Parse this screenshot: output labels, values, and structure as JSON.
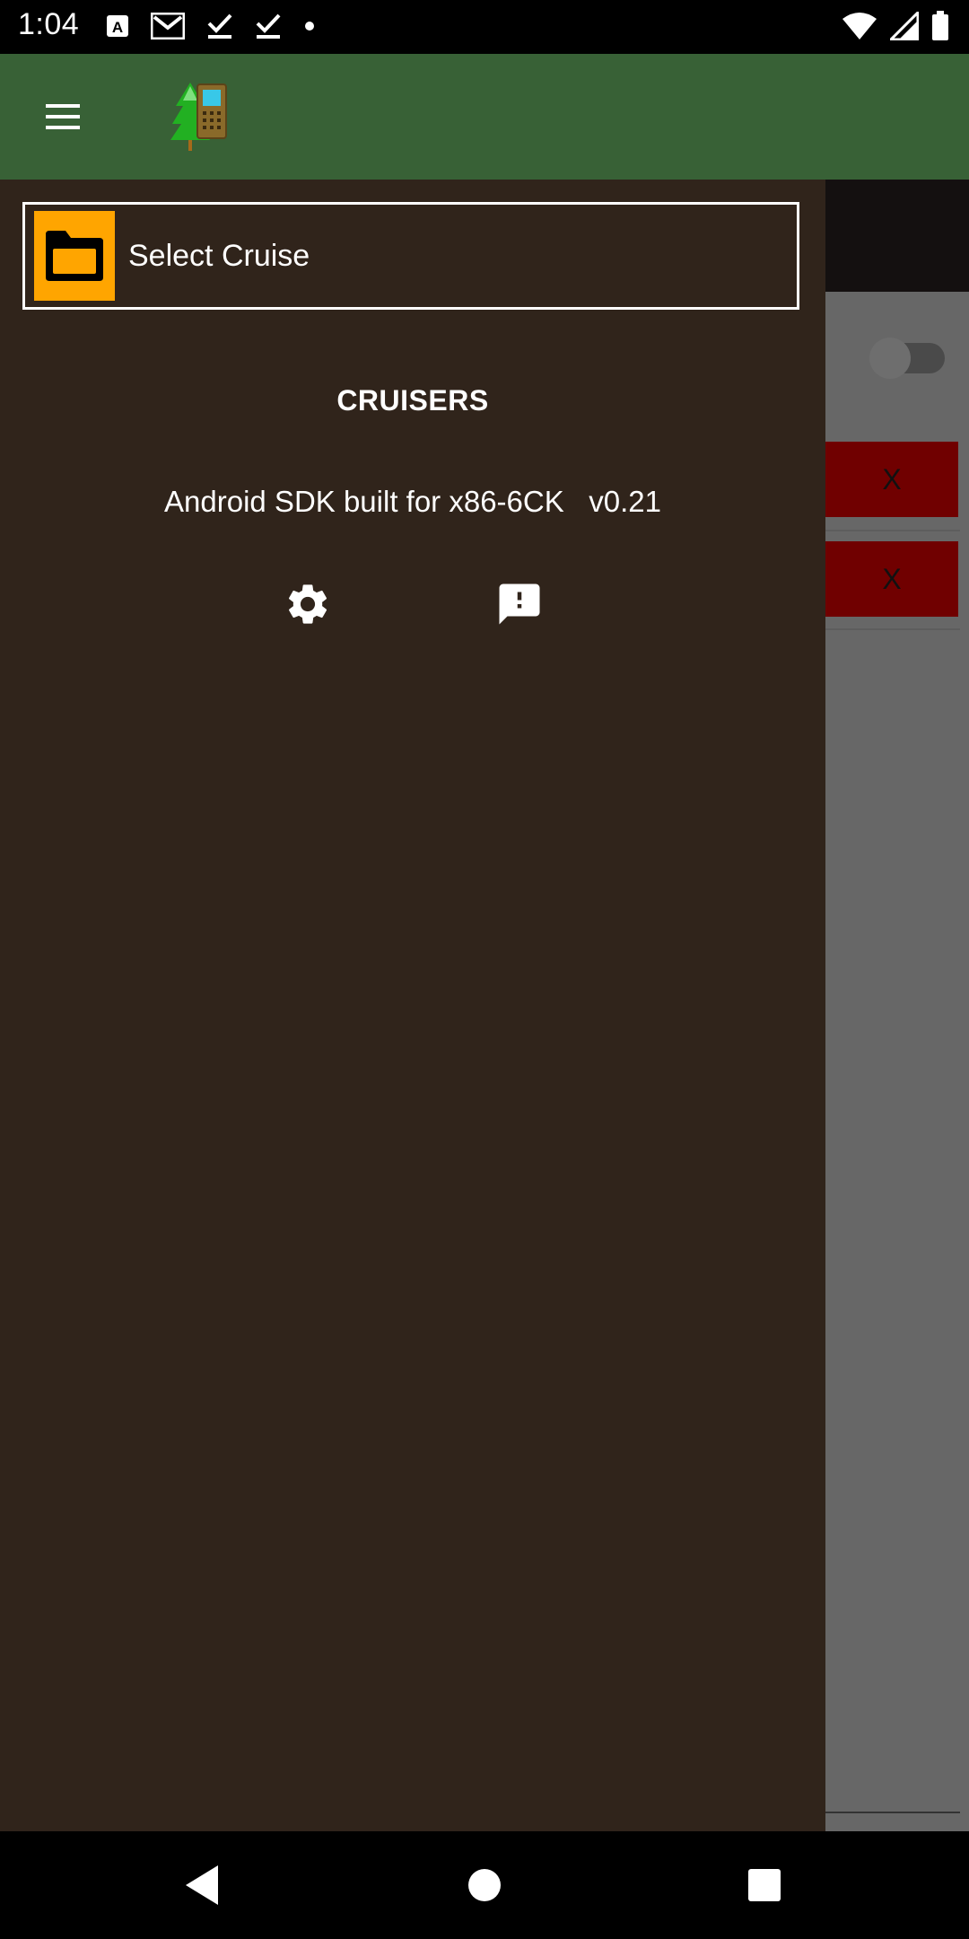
{
  "status_bar": {
    "time": "1:04",
    "left_icons": [
      "a-notification-icon",
      "gmail-icon",
      "download-done-icon",
      "download-done-icon",
      "dot-icon"
    ],
    "right_icons": [
      "wifi-icon",
      "signal-icon",
      "battery-icon"
    ]
  },
  "app_bar": {
    "menu_icon": "hamburger-menu-icon",
    "logo_icon": "tree-device-logo-icon",
    "color": "#386136"
  },
  "drawer": {
    "select_cruise_label": "Select Cruise",
    "folder_icon": "folder-icon",
    "heading": "CRUISERS",
    "device_info": "Android SDK built for x86-6CK   v0.21",
    "settings_icon": "gear-icon",
    "feedback_icon": "feedback-icon",
    "accent_color": "#ffa500",
    "background_color": "#30241b"
  },
  "background": {
    "x_buttons": [
      "X",
      "X"
    ],
    "x_button_color": "#700000"
  },
  "nav_bar": {
    "icons": [
      "back-icon",
      "home-icon",
      "recents-icon"
    ]
  }
}
